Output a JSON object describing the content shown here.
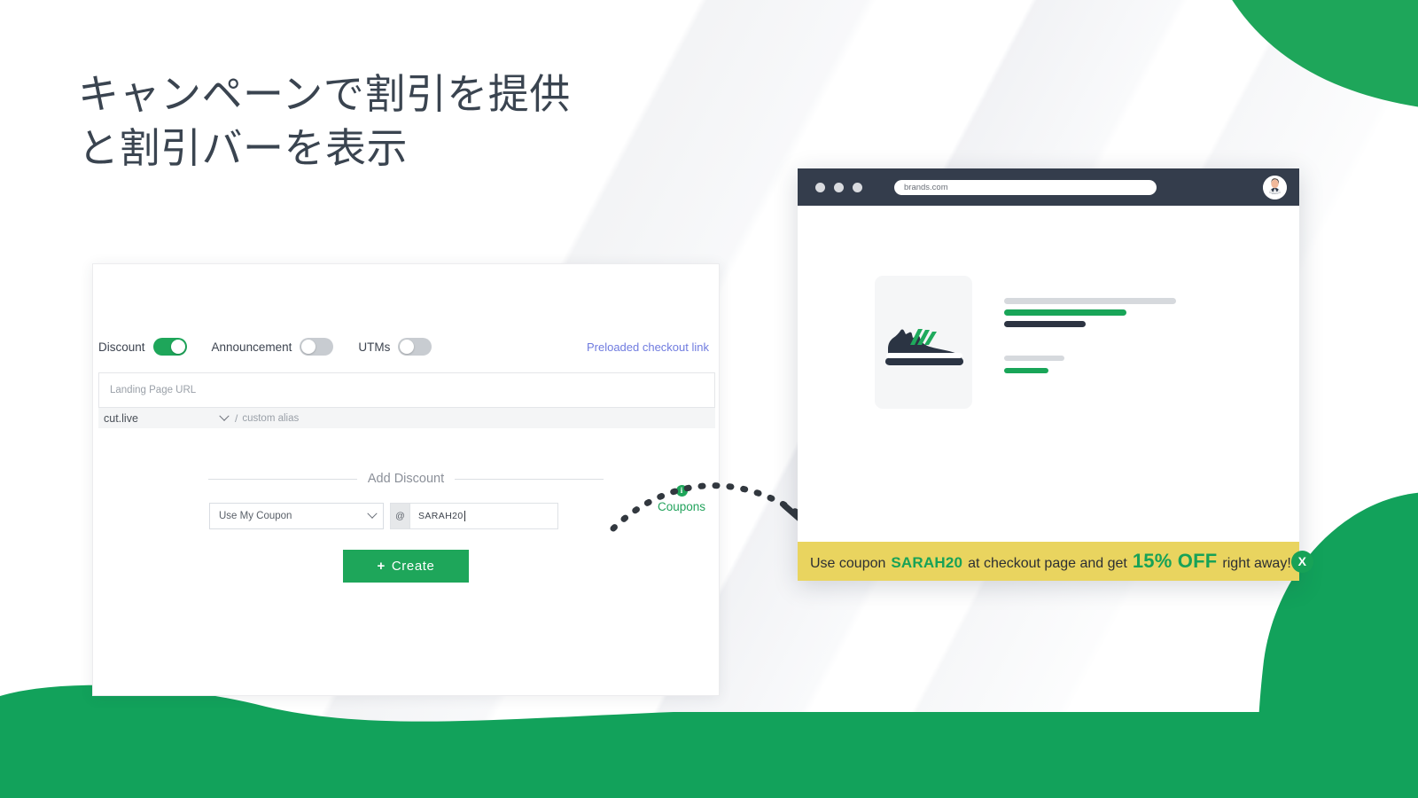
{
  "theme": {
    "brand_green": "#1ea65a",
    "dark_navy": "#343d4c",
    "link_indigo": "#6f7bdf",
    "banner_yellow": "#e9d45f",
    "banner_green": "#17a257"
  },
  "headline": {
    "line1": "キャンペーンで割引を提供",
    "line2": "と割引バーを表示",
    "full": "キャンペーンで割引を提供\nと割引バーを表示"
  },
  "form": {
    "toggles": [
      {
        "label": "Discount",
        "state": "on"
      },
      {
        "label": "Announcement",
        "state": "off"
      },
      {
        "label": "UTMs",
        "state": "off"
      }
    ],
    "preloaded_link": "Preloaded checkout link",
    "landing_url": {
      "placeholder": "Landing Page URL",
      "value": ""
    },
    "alias": {
      "domain": "cut.live",
      "separator": "/",
      "placeholder": "custom alias",
      "value": ""
    },
    "divider_label": "Add Discount",
    "coupon": {
      "select_value": "Use My Coupon",
      "prefix": "@",
      "code_value": "SARAH20",
      "coupons_link": "Coupons",
      "info_badge": "i"
    },
    "create_button": {
      "icon": "+",
      "label": "Create"
    }
  },
  "browser": {
    "url": "brands.com",
    "window_dots": 3,
    "avatar_alt": "user-avatar",
    "product": {
      "image_alt": "sneaker-product-image",
      "skeleton_lines": 5
    },
    "announcement": {
      "text_before": "Use coupon",
      "coupon_code": "SARAH20",
      "text_middle": "at checkout page and get",
      "discount": "15% OFF",
      "text_after": "right away!",
      "close_label": "X"
    }
  }
}
